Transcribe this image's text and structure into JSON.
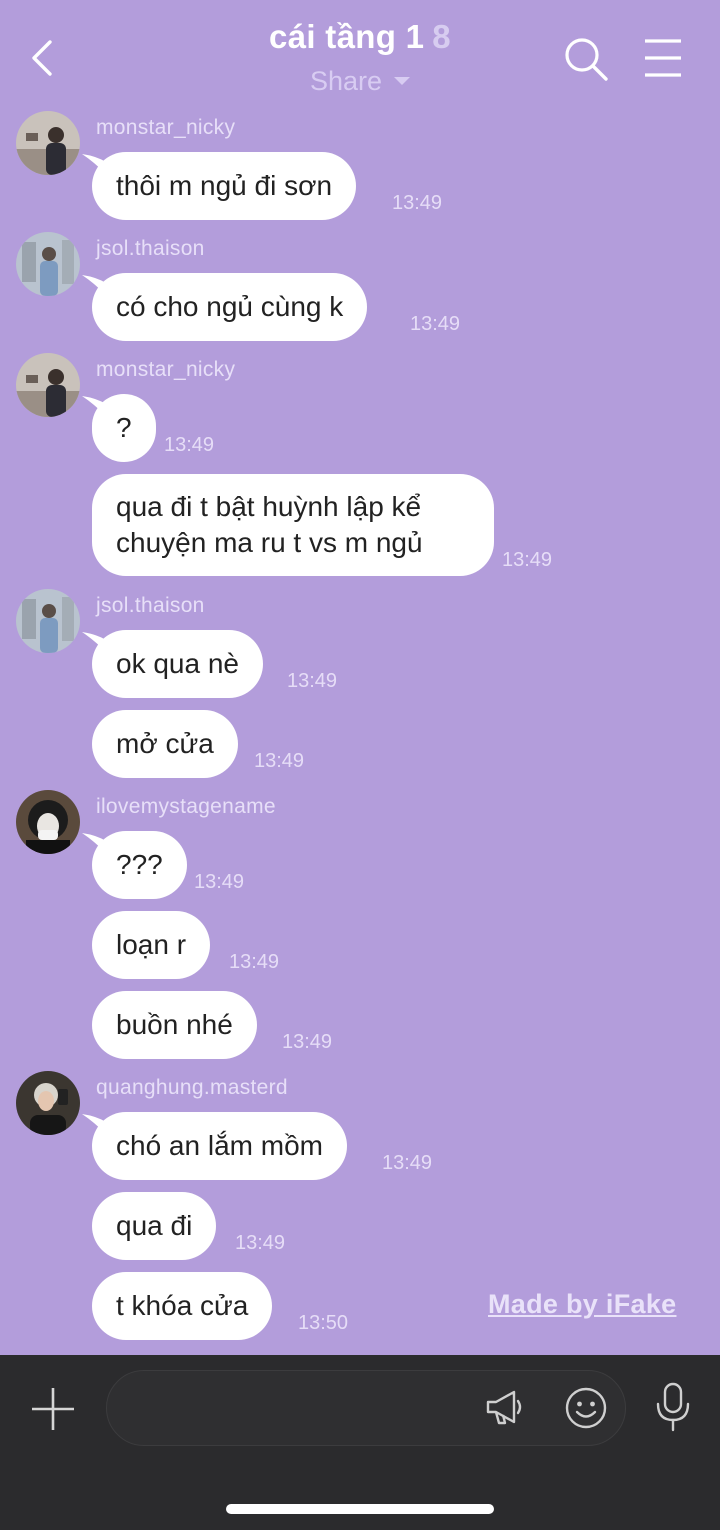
{
  "header": {
    "title": "cái tầng 1",
    "member_count": "8",
    "share_label": "Share"
  },
  "messages": [
    {
      "user": "monstar_nicky",
      "text": "thôi m ngủ đi sơn",
      "time": "13:49"
    },
    {
      "user": "jsol.thaison",
      "text": "có cho ngủ cùng k",
      "time": "13:49"
    },
    {
      "user": "monstar_nicky",
      "text": "?",
      "time": "13:49"
    },
    {
      "user": "",
      "text": "qua đi t bật huỳnh lập kể chuyện ma ru t vs m ngủ",
      "time": "13:49"
    },
    {
      "user": "jsol.thaison",
      "text": "ok qua nè",
      "time": "13:49"
    },
    {
      "user": "",
      "text": "mở cửa",
      "time": "13:49"
    },
    {
      "user": "ilovemystagename",
      "text": "???",
      "time": "13:49"
    },
    {
      "user": "",
      "text": "loạn r",
      "time": "13:49"
    },
    {
      "user": "",
      "text": "buồn nhé",
      "time": "13:49"
    },
    {
      "user": "quanghung.masterd",
      "text": "chó an lắm mồm",
      "time": "13:49"
    },
    {
      "user": "",
      "text": "qua đi",
      "time": "13:49"
    },
    {
      "user": "",
      "text": "t khóa cửa",
      "time": "13:50"
    }
  ],
  "watermark": "Made by iFake",
  "colors": {
    "background": "#B39DDB",
    "bubble": "#FFFFFF",
    "bottom_bar": "#2B2B2D"
  },
  "icons": {
    "back": "back-arrow-icon",
    "search": "search-icon",
    "menu": "menu-icon",
    "add": "plus-icon",
    "announce": "megaphone-icon",
    "emoji": "emoji-icon",
    "voice": "microphone-icon"
  }
}
